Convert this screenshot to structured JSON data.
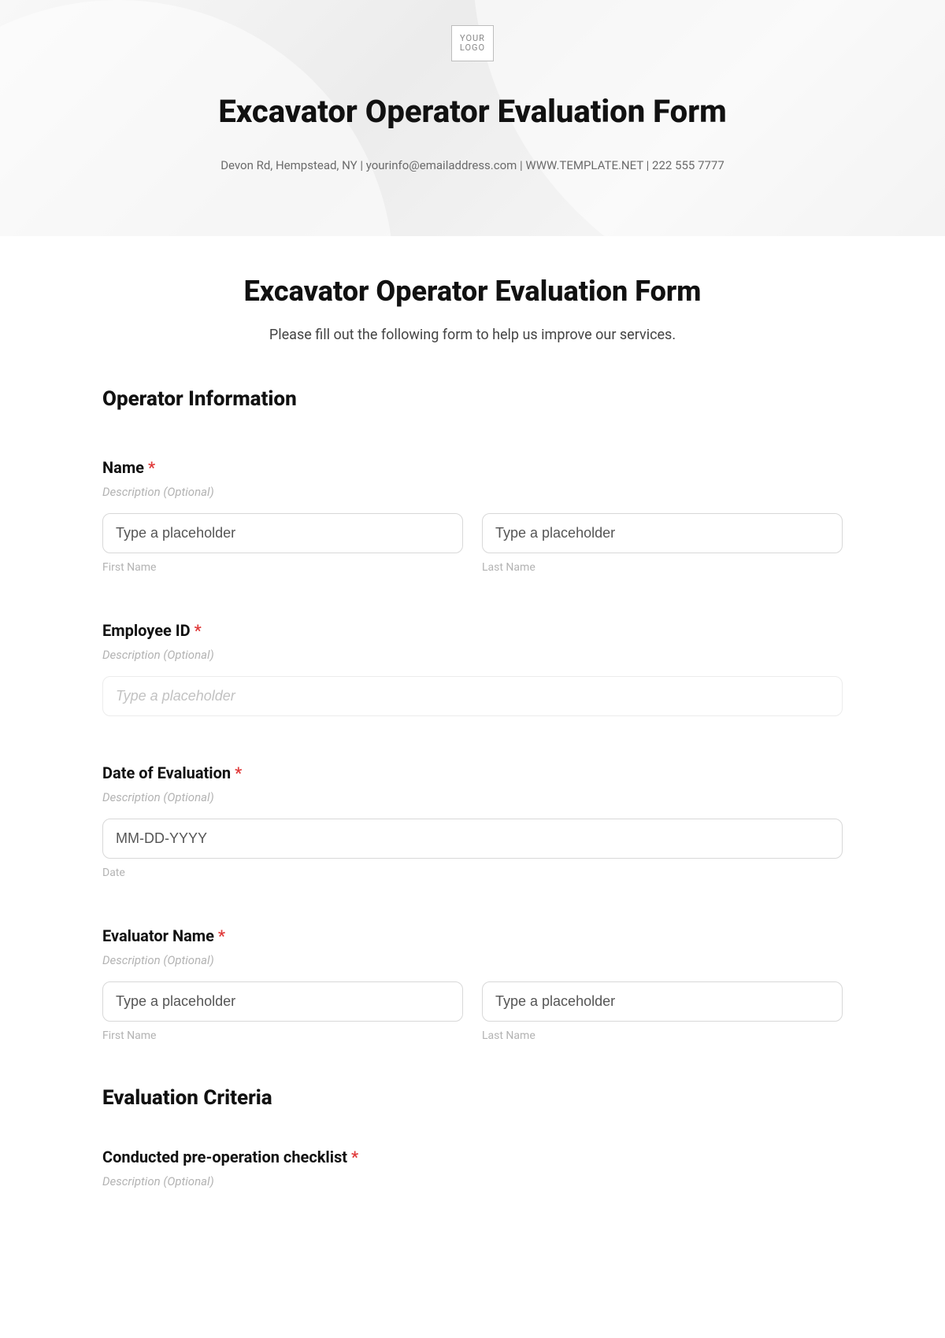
{
  "logo": {
    "line1": "YOUR",
    "line2": "LOGO"
  },
  "header": {
    "title": "Excavator Operator Evaluation Form",
    "contact": "Devon Rd, Hempstead, NY | yourinfo@emailaddress.com | WWW.TEMPLATE.NET | 222 555 7777"
  },
  "form": {
    "title": "Excavator Operator Evaluation Form",
    "description": "Please fill out the following form to help us improve our services."
  },
  "sections": {
    "operator_info": "Operator Information",
    "evaluation_criteria": "Evaluation Criteria"
  },
  "fields": {
    "name": {
      "label": "Name",
      "required": "*",
      "desc": "Description (Optional)",
      "first_placeholder": "Type a placeholder",
      "last_placeholder": "Type a placeholder",
      "first_sub": "First Name",
      "last_sub": "Last Name"
    },
    "employee_id": {
      "label": "Employee ID",
      "required": "*",
      "desc": "Description (Optional)",
      "placeholder": "Type a placeholder"
    },
    "date_eval": {
      "label": "Date of Evaluation",
      "required": "*",
      "desc": "Description (Optional)",
      "placeholder": "MM-DD-YYYY",
      "sub": "Date"
    },
    "evaluator": {
      "label": "Evaluator Name",
      "required": "*",
      "desc": "Description (Optional)",
      "first_placeholder": "Type a placeholder",
      "last_placeholder": "Type a placeholder",
      "first_sub": "First Name",
      "last_sub": "Last Name"
    },
    "preop": {
      "label": "Conducted pre-operation checklist",
      "required": "*",
      "desc": "Description (Optional)"
    }
  }
}
